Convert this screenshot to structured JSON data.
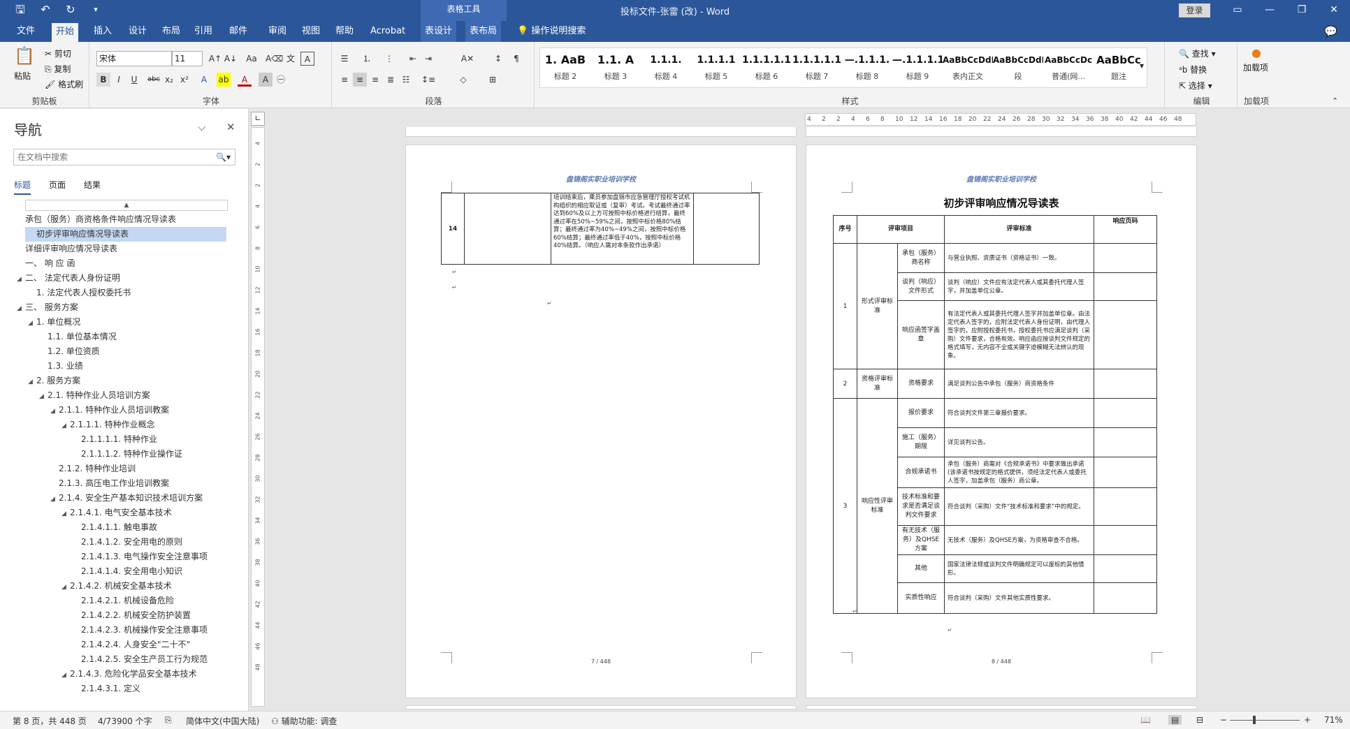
{
  "window": {
    "title": "投标文件-张雷 (改)  -  Word",
    "context_tools": "表格工具",
    "login": "登录"
  },
  "tabs": [
    "文件",
    "开始",
    "插入",
    "设计",
    "布局",
    "引用",
    "邮件",
    "审阅",
    "视图",
    "帮助",
    "Acrobat",
    "表设计",
    "表布局"
  ],
  "tell_me": "操作说明搜索",
  "ribbon": {
    "clipboard": {
      "paste": "粘贴",
      "cut": "剪切",
      "copy": "复制",
      "painter": "格式刷",
      "label": "剪贴板"
    },
    "font": {
      "name": "宋体",
      "size": "11",
      "label": "字体"
    },
    "paragraph_label": "段落",
    "styles": [
      {
        "p": "1.  AaB",
        "n": "标题 2"
      },
      {
        "p": "1.1.  A",
        "n": "标题 3"
      },
      {
        "p": "1.1.1.",
        "n": "标题 4"
      },
      {
        "p": "1.1.1.1",
        "n": "标题 5"
      },
      {
        "p": "1.1.1.1.1",
        "n": "标题 6"
      },
      {
        "p": "1.1.1.1.1",
        "n": "标题 7"
      },
      {
        "p": "—.1.1.1.",
        "n": "标题 8"
      },
      {
        "p": "—.1.1.1.1",
        "n": "标题 9"
      },
      {
        "p": "AaBbCcDdI",
        "n": "表内正文"
      },
      {
        "p": "AaBbCcDdI",
        "n": "段"
      },
      {
        "p": "AaBbCcDc",
        "n": "普通(网..."
      },
      {
        "p": "AaBbCc",
        "n": "题注"
      }
    ],
    "styles_label": "样式",
    "editing": {
      "find": "查找",
      "replace": "替换",
      "select": "选择",
      "label": "编辑"
    },
    "addins": {
      "add": "加载项",
      "label": "加载项"
    }
  },
  "nav": {
    "title": "导航",
    "search_placeholder": "在文档中搜索",
    "tabs": [
      "标题",
      "页面",
      "结果"
    ],
    "items": [
      {
        "t": "承包（服务）商资格条件响应情况导读表",
        "lv": 0,
        "tri": "",
        "sel": false
      },
      {
        "t": "初步评审响应情况导读表",
        "lv": 0,
        "tri": "",
        "sel": true
      },
      {
        "t": "详细评审响应情况导读表",
        "lv": 0,
        "tri": "",
        "sel": false
      },
      {
        "t": "一、 响 应 函",
        "lv": 0,
        "tri": "",
        "sel": false
      },
      {
        "t": "二、 法定代表人身份证明",
        "lv": 0,
        "tri": "◢",
        "sel": false
      },
      {
        "t": "1. 法定代表人授权委托书",
        "lv": 1,
        "tri": "",
        "sel": false
      },
      {
        "t": "三、 服务方案",
        "lv": 0,
        "tri": "◢",
        "sel": false
      },
      {
        "t": "1. 单位概况",
        "lv": 1,
        "tri": "◢",
        "sel": false
      },
      {
        "t": "1.1. 单位基本情况",
        "lv": 2,
        "tri": "",
        "sel": false
      },
      {
        "t": "1.2. 单位资质",
        "lv": 2,
        "tri": "",
        "sel": false
      },
      {
        "t": "1.3. 业绩",
        "lv": 2,
        "tri": "",
        "sel": false
      },
      {
        "t": "2. 服务方案",
        "lv": 1,
        "tri": "◢",
        "sel": false
      },
      {
        "t": "2.1. 特种作业人员培训方案",
        "lv": 2,
        "tri": "◢",
        "sel": false
      },
      {
        "t": "2.1.1. 特种作业人员培训教案",
        "lv": 3,
        "tri": "◢",
        "sel": false
      },
      {
        "t": "2.1.1.1. 特种作业概念",
        "lv": 4,
        "tri": "◢",
        "sel": false
      },
      {
        "t": "2.1.1.1.1. 特种作业",
        "lv": 5,
        "tri": "",
        "sel": false
      },
      {
        "t": "2.1.1.1.2. 特种作业操作证",
        "lv": 5,
        "tri": "",
        "sel": false
      },
      {
        "t": "2.1.2. 特种作业培训",
        "lv": 3,
        "tri": "",
        "sel": false
      },
      {
        "t": "2.1.3. 高压电工作业培训教案",
        "lv": 3,
        "tri": "",
        "sel": false
      },
      {
        "t": "2.1.4. 安全生产基本知识技术培训方案",
        "lv": 3,
        "tri": "◢",
        "sel": false
      },
      {
        "t": "2.1.4.1.  电气安全基本技术",
        "lv": 4,
        "tri": "◢",
        "sel": false
      },
      {
        "t": "2.1.4.1.1. 触电事故",
        "lv": 5,
        "tri": "",
        "sel": false
      },
      {
        "t": "2.1.4.1.2. 安全用电的原则",
        "lv": 5,
        "tri": "",
        "sel": false
      },
      {
        "t": "2.1.4.1.3. 电气操作安全注意事项",
        "lv": 5,
        "tri": "",
        "sel": false
      },
      {
        "t": "2.1.4.1.4. 安全用电小知识",
        "lv": 5,
        "tri": "",
        "sel": false
      },
      {
        "t": "2.1.4.2.  机械安全基本技术",
        "lv": 4,
        "tri": "◢",
        "sel": false
      },
      {
        "t": "2.1.4.2.1. 机械设备危险",
        "lv": 5,
        "tri": "",
        "sel": false
      },
      {
        "t": "2.1.4.2.2. 机械安全防护装置",
        "lv": 5,
        "tri": "",
        "sel": false
      },
      {
        "t": "2.1.4.2.3. 机械操作安全注意事项",
        "lv": 5,
        "tri": "",
        "sel": false
      },
      {
        "t": "2.1.4.2.4. 人身安全\"二十不\"",
        "lv": 5,
        "tri": "",
        "sel": false
      },
      {
        "t": "2.1.4.2.5. 安全生产员工行为规范",
        "lv": 5,
        "tri": "",
        "sel": false
      },
      {
        "t": "2.1.4.3.  危险化学品安全基本技术",
        "lv": 4,
        "tri": "◢",
        "sel": false
      },
      {
        "t": "2.1.4.3.1. 定义",
        "lv": 5,
        "tri": "",
        "sel": false
      }
    ]
  },
  "page7": {
    "header": "盘锦阁实职业培训学校",
    "row_no": "14",
    "content": "培训结束后，乘员参加盘锦市应急管理厅授权考试机构组织的相应取证或（复审）考试。考试最终通过率达到60%及以上方可按照中标价格进行结算，最终通过率在50%~59%之间，按照中标价格80%结算；最终通过率为40%~49%之间，按照中标价格60%结算；最终通过率低于40%，按照中标价格40%结算。（响应人需对本条款作出承诺）",
    "footer": "7 / 448"
  },
  "page8": {
    "header": "盘锦阁实职业培训学校",
    "title": "初步评审响应情况导读表",
    "cols": [
      "序号",
      "评审项目",
      "评审标准",
      "响应页码"
    ],
    "groups": [
      {
        "no": "1",
        "name": "形式评审标准"
      },
      {
        "no": "2",
        "name": "资格评审标准"
      },
      {
        "no": "3",
        "name": "响应性评审标准"
      }
    ],
    "rows": [
      {
        "item": "承包（服务）商名称",
        "std": "与营业执照、资质证书（资格证书）一致。"
      },
      {
        "item": "谈判（响应）文件形式",
        "std": "谈判（响应）文件应有法定代表人或其委托代理人签字，并加盖单位公章。"
      },
      {
        "item": "响应函签字盖章",
        "std": "有法定代表人或其委托代理人签字并加盖单位章。由法定代表人签字的，应附法定代表人身份证明，由代理人签字的，应附授权委托书，授权委托书应满足谈判（采购）文件要求，合格有效。响应函应按谈判文件规定的格式填写，无内容不全或关键字迹模糊无法辨认的现象。"
      },
      {
        "item": "资格要求",
        "std": "满足谈判公告中承包（服务）商资格条件"
      },
      {
        "item": "报价要求",
        "std": "符合谈判文件第三章报价要求。"
      },
      {
        "item": "施工（服务）期限",
        "std": "详见谈判公告。"
      },
      {
        "item": "合规承诺书",
        "std": "承包（服务）商需对《合规承诺书》中要求做出承诺(该承诺书按规定的格式提供，须经法定代表人或委托人签字，加盖承包（服务）商公章。"
      },
      {
        "item": "技术标准和要求是否满足谈判文件要求",
        "std": "符合谈判（采购）文件“技术标准和要求”中的规定。"
      },
      {
        "item": "有无技术（服务）及QHSE方案",
        "std": "无技术（服务）及QHSE方案，为资格审查不合格。"
      },
      {
        "item": "其他",
        "std": "国家法律法规或谈判文件明确规定可以废标的其他情形。"
      },
      {
        "item": "实质性响应",
        "std": "符合谈判（采购）文件其他实质性要求。"
      }
    ],
    "footer": "8 / 448"
  },
  "status": {
    "page": "第 8 页，共 448 页",
    "words": "4/73900 个字",
    "lang": "简体中文(中国大陆)",
    "access": "辅助功能: 调查",
    "zoom": "71%"
  },
  "colors": {
    "brand": "#2b579a",
    "selected": "#c4d8f3"
  }
}
